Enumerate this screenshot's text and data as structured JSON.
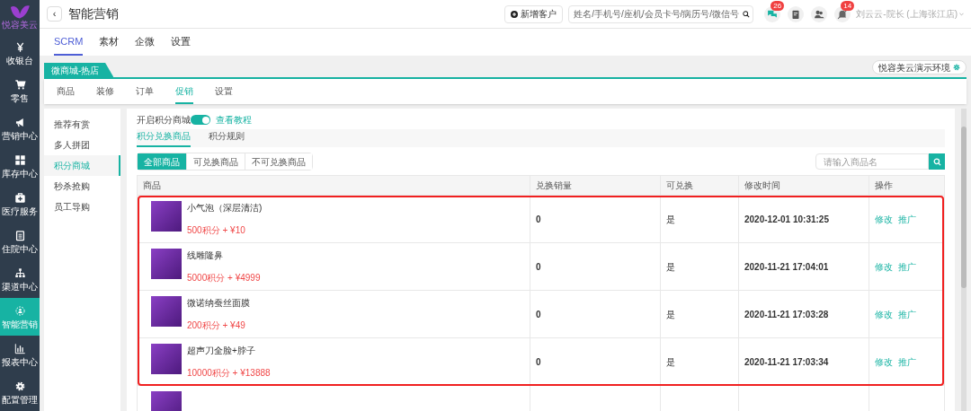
{
  "brand": {
    "name": "悦容美云"
  },
  "nav": [
    {
      "label": "收银台",
      "selected": false
    },
    {
      "label": "零售",
      "selected": false
    },
    {
      "label": "营销中心",
      "selected": false
    },
    {
      "label": "库存中心",
      "selected": false
    },
    {
      "label": "医疗服务",
      "selected": false
    },
    {
      "label": "住院中心",
      "selected": false
    },
    {
      "label": "渠道中心",
      "selected": false
    },
    {
      "label": "智能营销",
      "selected": true
    },
    {
      "label": "报表中心",
      "selected": false
    },
    {
      "label": "配置管理",
      "selected": false
    }
  ],
  "header": {
    "back": "‹",
    "title": "智能营销",
    "new_button": "新增客户",
    "search_placeholder": "姓名/手机号/座机/会员卡号/病历号/微信号",
    "message_count": "26",
    "alert_count": "14",
    "user": "刘云云-院长 (上海张江店)"
  },
  "tabs": [
    {
      "label": "SCRM",
      "selected": true
    },
    {
      "label": "素材",
      "selected": false
    },
    {
      "label": "企微",
      "selected": false
    },
    {
      "label": "设置",
      "selected": false
    }
  ],
  "shop_tab": "微商城-热店",
  "environment": "悦容美云演示环境",
  "sub_tabs": [
    {
      "label": "商品",
      "selected": false
    },
    {
      "label": "装修",
      "selected": false
    },
    {
      "label": "订单",
      "selected": false
    },
    {
      "label": "促销",
      "selected": true
    },
    {
      "label": "设置",
      "selected": false
    }
  ],
  "promo_menu": [
    {
      "label": "推荐有赏",
      "selected": false
    },
    {
      "label": "多人拼团",
      "selected": false
    },
    {
      "label": "积分商城",
      "selected": true
    },
    {
      "label": "秒杀抢购",
      "selected": false
    },
    {
      "label": "员工导购",
      "selected": false
    }
  ],
  "toggle": {
    "label": "开启积分商城",
    "on": true,
    "link": "查看教程"
  },
  "section_tabs": [
    {
      "label": "积分兑换商品",
      "selected": true
    },
    {
      "label": "积分规则",
      "selected": false
    }
  ],
  "filters": [
    {
      "label": "全部商品",
      "selected": true
    },
    {
      "label": "可兑换商品",
      "selected": false
    },
    {
      "label": "不可兑换商品",
      "selected": false
    }
  ],
  "product_search": {
    "placeholder": "请输入商品名"
  },
  "table": {
    "columns": [
      "商品",
      "兑换销量",
      "可兑换",
      "修改时间",
      "操作"
    ],
    "rows": [
      {
        "name": "小气泡（深层清洁)",
        "price": "500积分 + ¥10",
        "sales": "0",
        "exchangeable": "是",
        "modified": "2020-12-01 10:31:25",
        "actions": [
          "修改",
          "推广"
        ]
      },
      {
        "name": "线雕隆鼻",
        "price": "5000积分 + ¥4999",
        "sales": "0",
        "exchangeable": "是",
        "modified": "2020-11-21 17:04:01",
        "actions": [
          "修改",
          "推广"
        ]
      },
      {
        "name": "微诺纳蚕丝面膜",
        "price": "200积分 + ¥49",
        "sales": "0",
        "exchangeable": "是",
        "modified": "2020-11-21 17:03:28",
        "actions": [
          "修改",
          "推广"
        ]
      },
      {
        "name": "超声刀全脸+脖子",
        "price": "10000积分 + ¥13888",
        "sales": "0",
        "exchangeable": "是",
        "modified": "2020-11-21 17:03:34",
        "actions": [
          "修改",
          "推广"
        ]
      }
    ]
  }
}
